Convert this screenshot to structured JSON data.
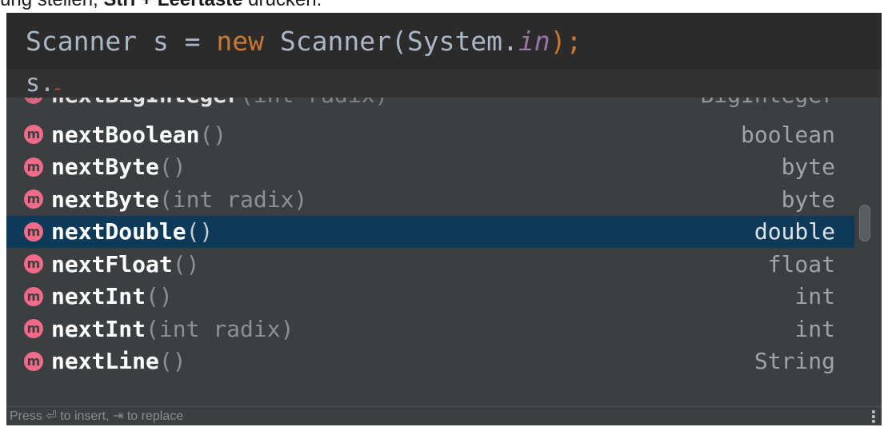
{
  "doc": {
    "prefix": "ung stellen, ",
    "keys": "Strl + Leertaste",
    "suffix": " drücken."
  },
  "editor": {
    "code": {
      "type": "Scanner",
      "var": " s = ",
      "keyword": "new",
      "call": " Scanner(System.",
      "field": "in",
      "end": ");"
    },
    "current_line": "s."
  },
  "completion": {
    "partial_item": {
      "name": "nextBigInteger",
      "params": "(int radix)",
      "type": "BigInteger"
    },
    "icon_letter": "m",
    "items": [
      {
        "name": "nextBoolean",
        "params": "()",
        "type": "boolean"
      },
      {
        "name": "nextByte",
        "params": "()",
        "type": "byte"
      },
      {
        "name": "nextByte",
        "params": "(int radix)",
        "type": "byte"
      },
      {
        "name": "nextDouble",
        "params": "()",
        "type": "double",
        "selected": true
      },
      {
        "name": "nextFloat",
        "params": "()",
        "type": "float"
      },
      {
        "name": "nextInt",
        "params": "()",
        "type": "int"
      },
      {
        "name": "nextInt",
        "params": "(int radix)",
        "type": "int"
      },
      {
        "name": "nextLine",
        "params": "()",
        "type": "String"
      }
    ],
    "selected_index": 3,
    "hint": "Press ⏎ to insert, ⇥ to replace",
    "more_label": "⋮"
  },
  "colors": {
    "editor_bg": "#2b2b2b",
    "popup_bg": "#3c3f41",
    "selection": "#0d3a58",
    "keyword": "#cc7832",
    "static_field": "#9876aa",
    "method_icon": "#f06b88"
  }
}
